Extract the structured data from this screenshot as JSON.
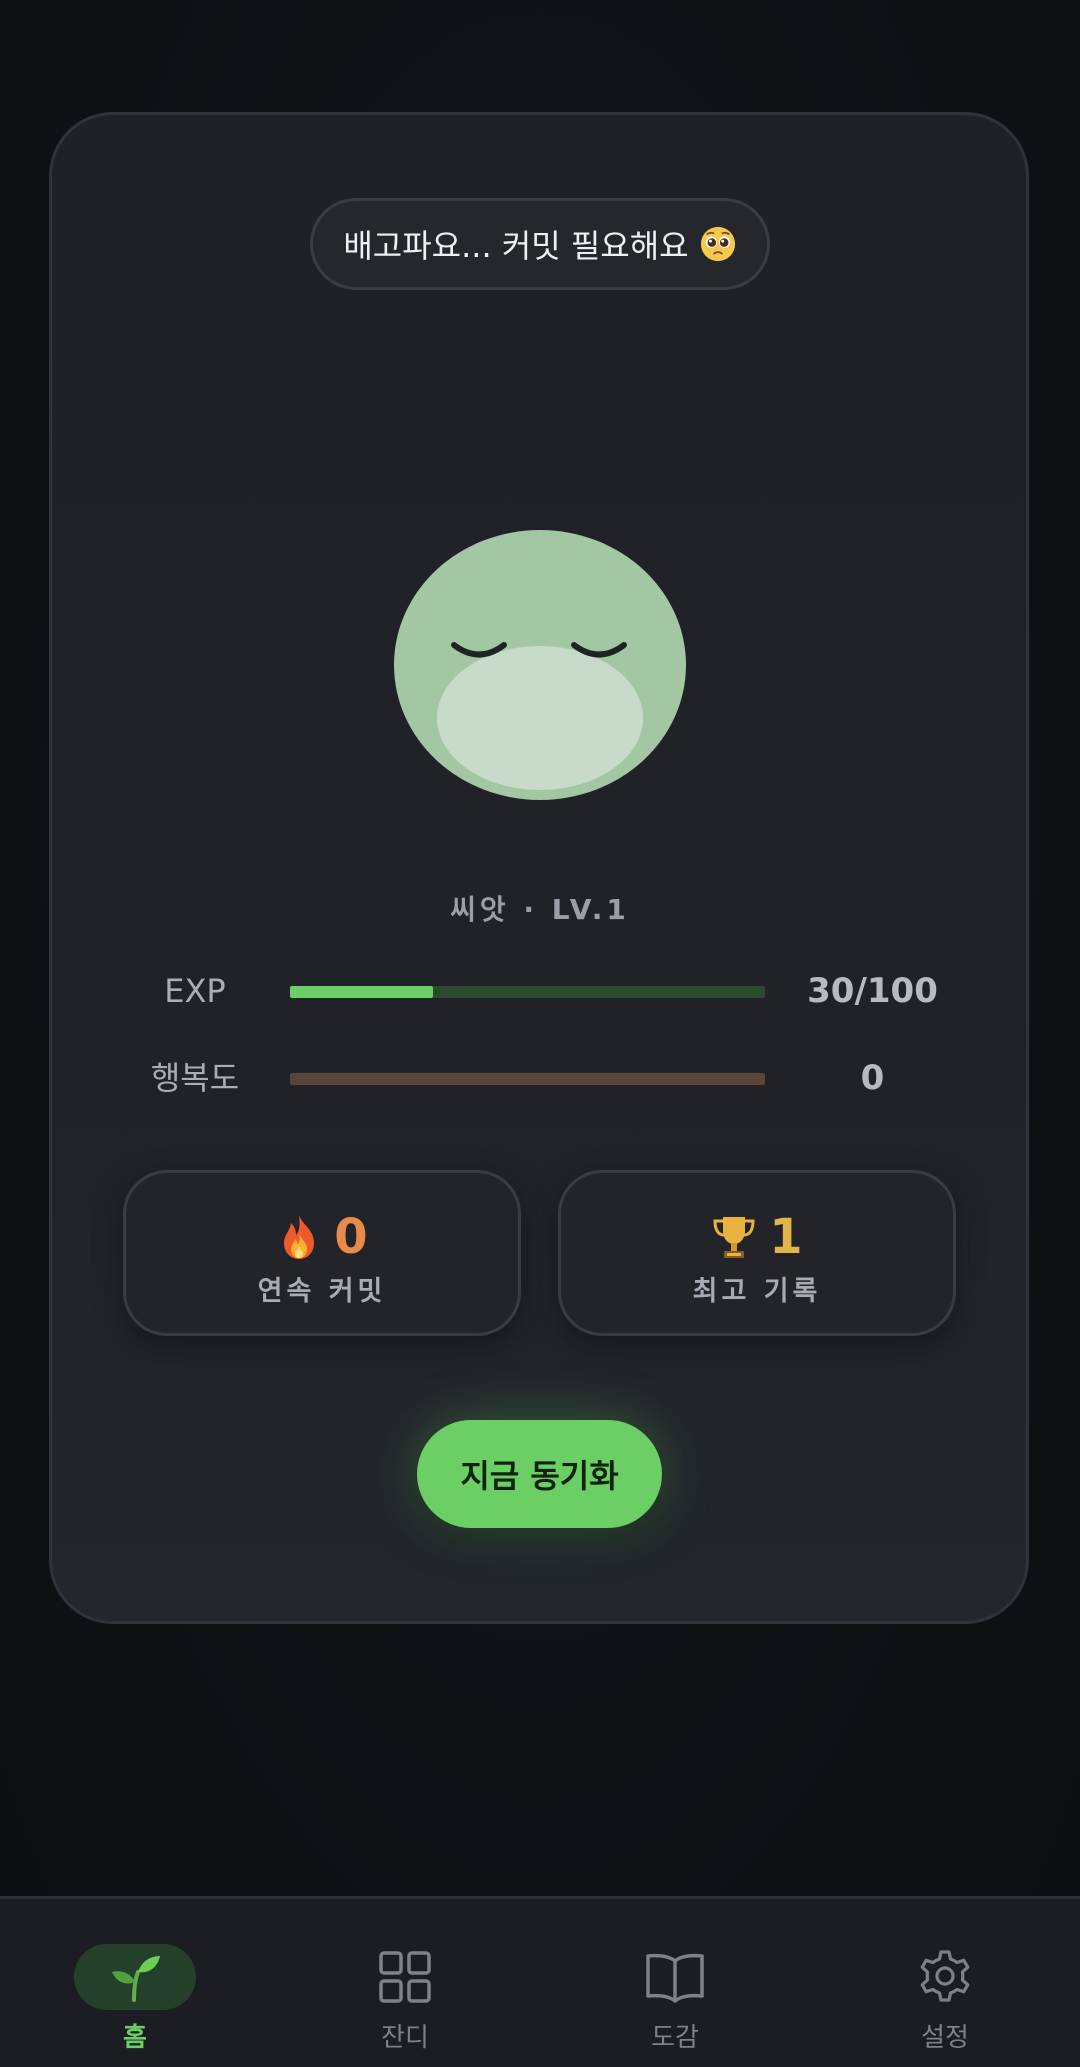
{
  "speech_bubble": {
    "text": "배고파요... 커밋 필요해요",
    "emoji": "pleading-face-icon"
  },
  "pet": {
    "label": "씨앗 · LV.1"
  },
  "stats": {
    "exp": {
      "label": "EXP",
      "value": "30/100",
      "fraction": 0.3,
      "fill_color": "#6bcf66",
      "track_color": "#2c4a30"
    },
    "happiness": {
      "label": "행복도",
      "value": "0",
      "fraction": 0.0,
      "fill_color": "#b9845a",
      "track_color": "#5a4636"
    }
  },
  "streak": {
    "icon": "fire-icon",
    "value": "0",
    "caption": "연속 커밋",
    "color": "#e98a4a"
  },
  "best": {
    "icon": "trophy-icon",
    "value": "1",
    "caption": "최고 기록",
    "color": "#e4b44c"
  },
  "sync_button": {
    "label": "지금 동기화",
    "color": "#6bcf66"
  },
  "tabs": [
    {
      "label": "홈",
      "icon": "sprout-icon",
      "active": true
    },
    {
      "label": "잔디",
      "icon": "grid-icon",
      "active": false
    },
    {
      "label": "도감",
      "icon": "book-icon",
      "active": false
    },
    {
      "label": "설정",
      "icon": "gear-icon",
      "active": false
    }
  ]
}
